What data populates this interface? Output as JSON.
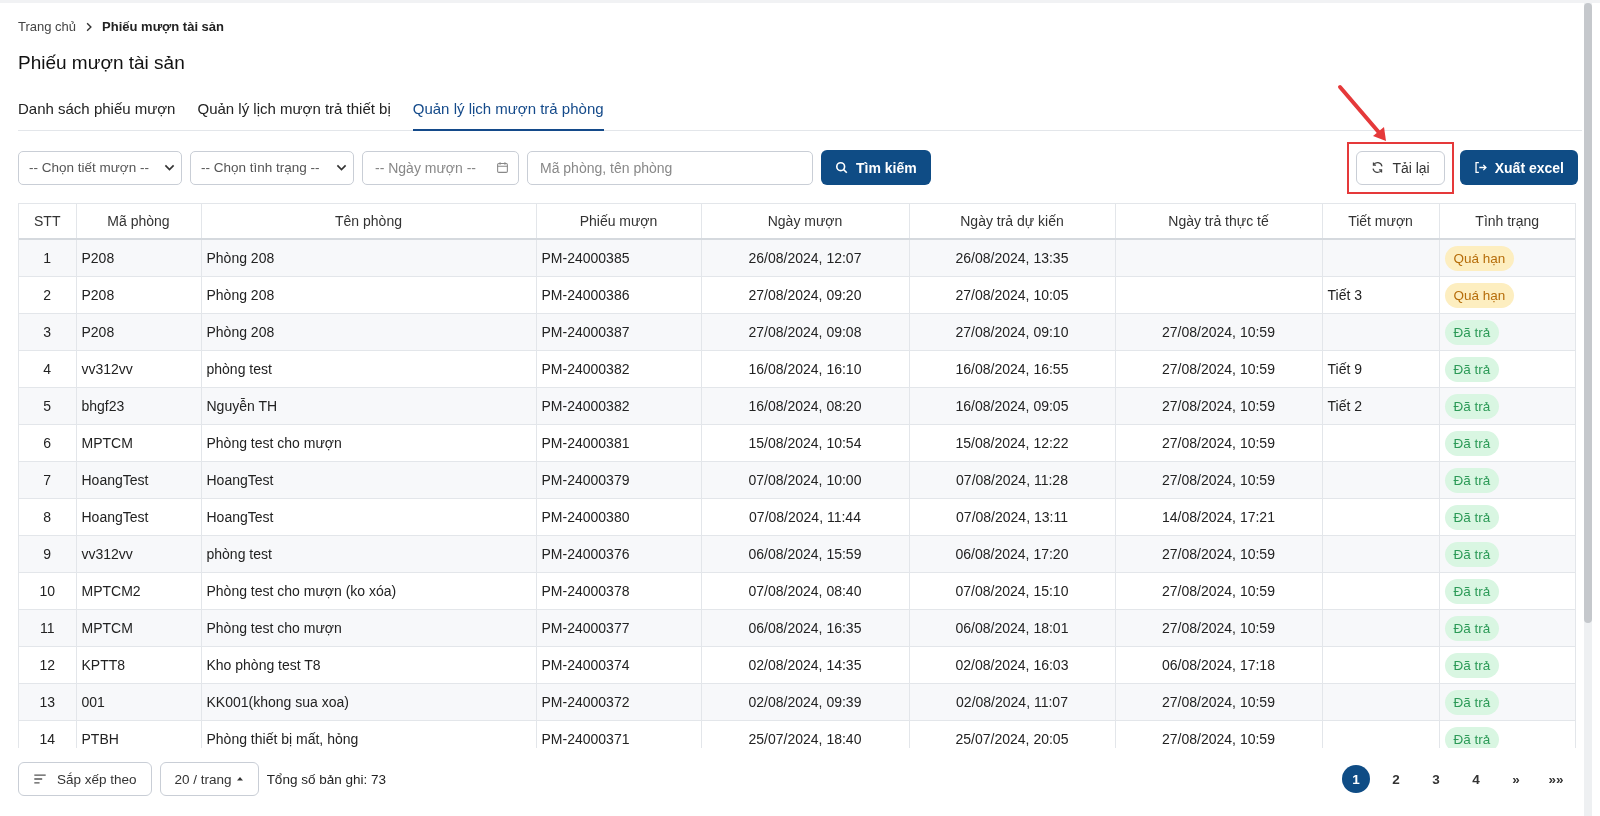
{
  "breadcrumb": [
    "Trang chủ",
    "Phiếu mượn tài sản"
  ],
  "title": "Phiếu mượn tài sản",
  "tabs": [
    {
      "label": "Danh sách phiếu mượn",
      "selected": false
    },
    {
      "label": "Quản lý lịch mượn trả thiết bị",
      "selected": false
    },
    {
      "label": "Quản lý lịch mượn trả phòng",
      "selected": true
    }
  ],
  "filters": [
    {
      "kind": "select",
      "placeholder": "-- Chọn tiết mượn --"
    },
    {
      "kind": "select",
      "placeholder": "-- Chọn tình trạng --"
    },
    {
      "kind": "date",
      "placeholder": "-- Ngày mượn --"
    },
    {
      "kind": "text",
      "placeholder": "Mã phòng, tên phòng"
    }
  ],
  "search_button": "Tìm kiếm",
  "reload_button": "Tải lại",
  "export_button": "Xuất excel",
  "table": {
    "columns": [
      "STT",
      "Mã phòng",
      "Tên phòng",
      "Phiếu mượn",
      "Ngày mượn",
      "Ngày trả dự kiến",
      "Ngày trả thực tế",
      "Tiết mượn",
      "Tình trạng"
    ],
    "rows": [
      {
        "cells": [
          "1",
          "P208",
          "Phòng 208",
          "PM-24000385",
          "26/08/2024, 12:07",
          "26/08/2024, 13:35",
          "",
          ""
        ],
        "status": {
          "text": "Quá hạn",
          "kind": "overdue"
        }
      },
      {
        "cells": [
          "2",
          "P208",
          "Phòng 208",
          "PM-24000386",
          "27/08/2024, 09:20",
          "27/08/2024, 10:05",
          "",
          "Tiết 3"
        ],
        "status": {
          "text": "Quá hạn",
          "kind": "overdue"
        }
      },
      {
        "cells": [
          "3",
          "P208",
          "Phòng 208",
          "PM-24000387",
          "27/08/2024, 09:08",
          "27/08/2024, 09:10",
          "27/08/2024, 10:59",
          ""
        ],
        "status": {
          "text": "Đã trả",
          "kind": "returned"
        }
      },
      {
        "cells": [
          "4",
          "vv312vv",
          "phòng test",
          "PM-24000382",
          "16/08/2024, 16:10",
          "16/08/2024, 16:55",
          "27/08/2024, 10:59",
          "Tiết 9"
        ],
        "status": {
          "text": "Đã trả",
          "kind": "returned"
        }
      },
      {
        "cells": [
          "5",
          "bhgf23",
          "Nguyễn TH",
          "PM-24000382",
          "16/08/2024, 08:20",
          "16/08/2024, 09:05",
          "27/08/2024, 10:59",
          "Tiết 2"
        ],
        "status": {
          "text": "Đã trả",
          "kind": "returned"
        }
      },
      {
        "cells": [
          "6",
          "MPTCM",
          "Phòng test cho mượn",
          "PM-24000381",
          "15/08/2024, 10:54",
          "15/08/2024, 12:22",
          "27/08/2024, 10:59",
          ""
        ],
        "status": {
          "text": "Đã trả",
          "kind": "returned"
        }
      },
      {
        "cells": [
          "7",
          "HoangTest",
          "HoangTest",
          "PM-24000379",
          "07/08/2024, 10:00",
          "07/08/2024, 11:28",
          "27/08/2024, 10:59",
          ""
        ],
        "status": {
          "text": "Đã trả",
          "kind": "returned"
        }
      },
      {
        "cells": [
          "8",
          "HoangTest",
          "HoangTest",
          "PM-24000380",
          "07/08/2024, 11:44",
          "07/08/2024, 13:11",
          "14/08/2024, 17:21",
          ""
        ],
        "status": {
          "text": "Đã trả",
          "kind": "returned"
        }
      },
      {
        "cells": [
          "9",
          "vv312vv",
          "phòng test",
          "PM-24000376",
          "06/08/2024, 15:59",
          "06/08/2024, 17:20",
          "27/08/2024, 10:59",
          ""
        ],
        "status": {
          "text": "Đã trả",
          "kind": "returned"
        }
      },
      {
        "cells": [
          "10",
          "MPTCM2",
          "Phòng test cho mượn (ko xóa)",
          "PM-24000378",
          "07/08/2024, 08:40",
          "07/08/2024, 15:10",
          "27/08/2024, 10:59",
          ""
        ],
        "status": {
          "text": "Đã trả",
          "kind": "returned"
        }
      },
      {
        "cells": [
          "11",
          "MPTCM",
          "Phòng test cho mượn",
          "PM-24000377",
          "06/08/2024, 16:35",
          "06/08/2024, 18:01",
          "27/08/2024, 10:59",
          ""
        ],
        "status": {
          "text": "Đã trả",
          "kind": "returned"
        }
      },
      {
        "cells": [
          "12",
          "KPTT8",
          "Kho phòng test T8",
          "PM-24000374",
          "02/08/2024, 14:35",
          "02/08/2024, 16:03",
          "06/08/2024, 17:18",
          ""
        ],
        "status": {
          "text": "Đã trả",
          "kind": "returned"
        }
      },
      {
        "cells": [
          "13",
          "001",
          "KK001(khong sua xoa)",
          "PM-24000372",
          "02/08/2024, 09:39",
          "02/08/2024, 11:07",
          "27/08/2024, 10:59",
          ""
        ],
        "status": {
          "text": "Đã trả",
          "kind": "returned"
        }
      },
      {
        "cells": [
          "14",
          "PTBH",
          "Phòng thiết bị mất, hỏng",
          "PM-24000371",
          "25/07/2024, 18:40",
          "25/07/2024, 20:05",
          "27/08/2024, 10:59",
          ""
        ],
        "status": {
          "text": "Đã trả",
          "kind": "returned"
        }
      }
    ]
  },
  "footer": {
    "sort_button": "Sắp xếp theo",
    "page_size": "20 / trang",
    "total": "Tổng số bản ghi: 73",
    "pages": [
      {
        "label": "1",
        "selected": true
      },
      {
        "label": "2",
        "selected": false
      },
      {
        "label": "3",
        "selected": false
      },
      {
        "label": "4",
        "selected": false
      }
    ],
    "next": "»",
    "last": "»»"
  }
}
